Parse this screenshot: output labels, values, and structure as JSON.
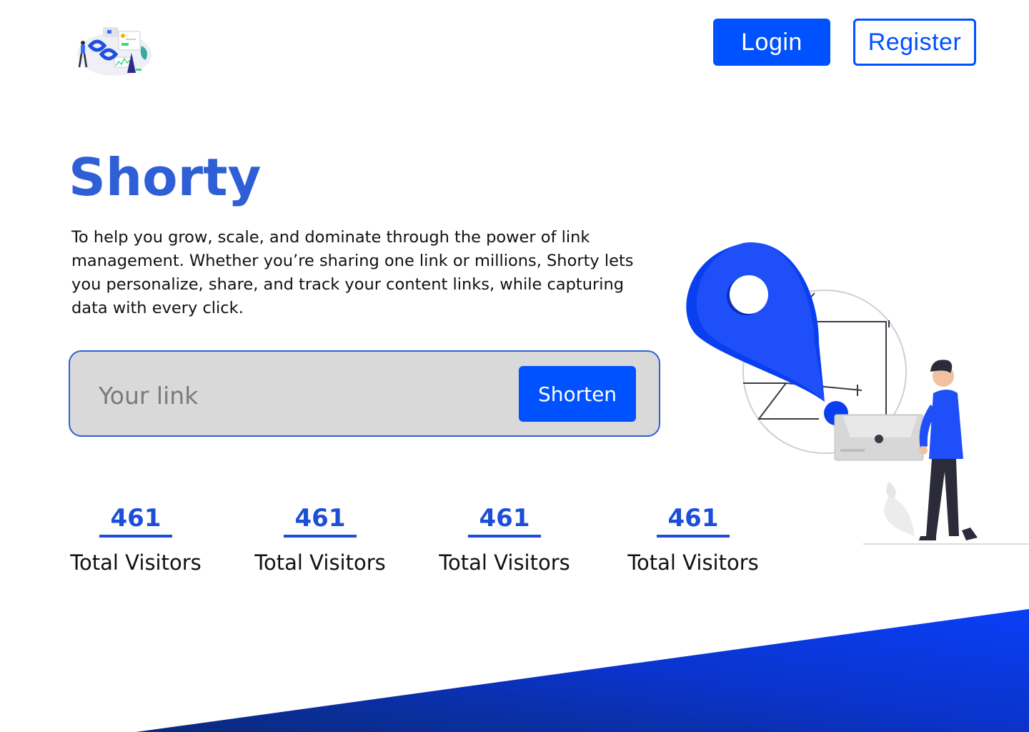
{
  "header": {
    "logo_icon": "link-analytics-illustration",
    "login_label": "Login",
    "register_label": "Register"
  },
  "hero": {
    "title": "Shorty",
    "description": "To help you grow, scale, and dominate through the power of link management. Whether you’re sharing one link or millions, Shorty lets you personalize, share, and track your content links, while capturing data with every click."
  },
  "shortener": {
    "placeholder": "Your link",
    "value": "",
    "button_label": "Shorten"
  },
  "stats": [
    {
      "value": "461",
      "label": "Total Visitors"
    },
    {
      "value": "461",
      "label": "Total Visitors"
    },
    {
      "value": "461",
      "label": "Total Visitors"
    },
    {
      "value": "461",
      "label": "Total Visitors"
    }
  ],
  "illustration_icon": "location-pin-with-person-illustration",
  "colors": {
    "accent": "#0051ff",
    "title": "#2f5fd6",
    "stat_value": "#1c4fd8",
    "input_bg": "#d9d9d9",
    "wedge": "#0a3ff0"
  }
}
